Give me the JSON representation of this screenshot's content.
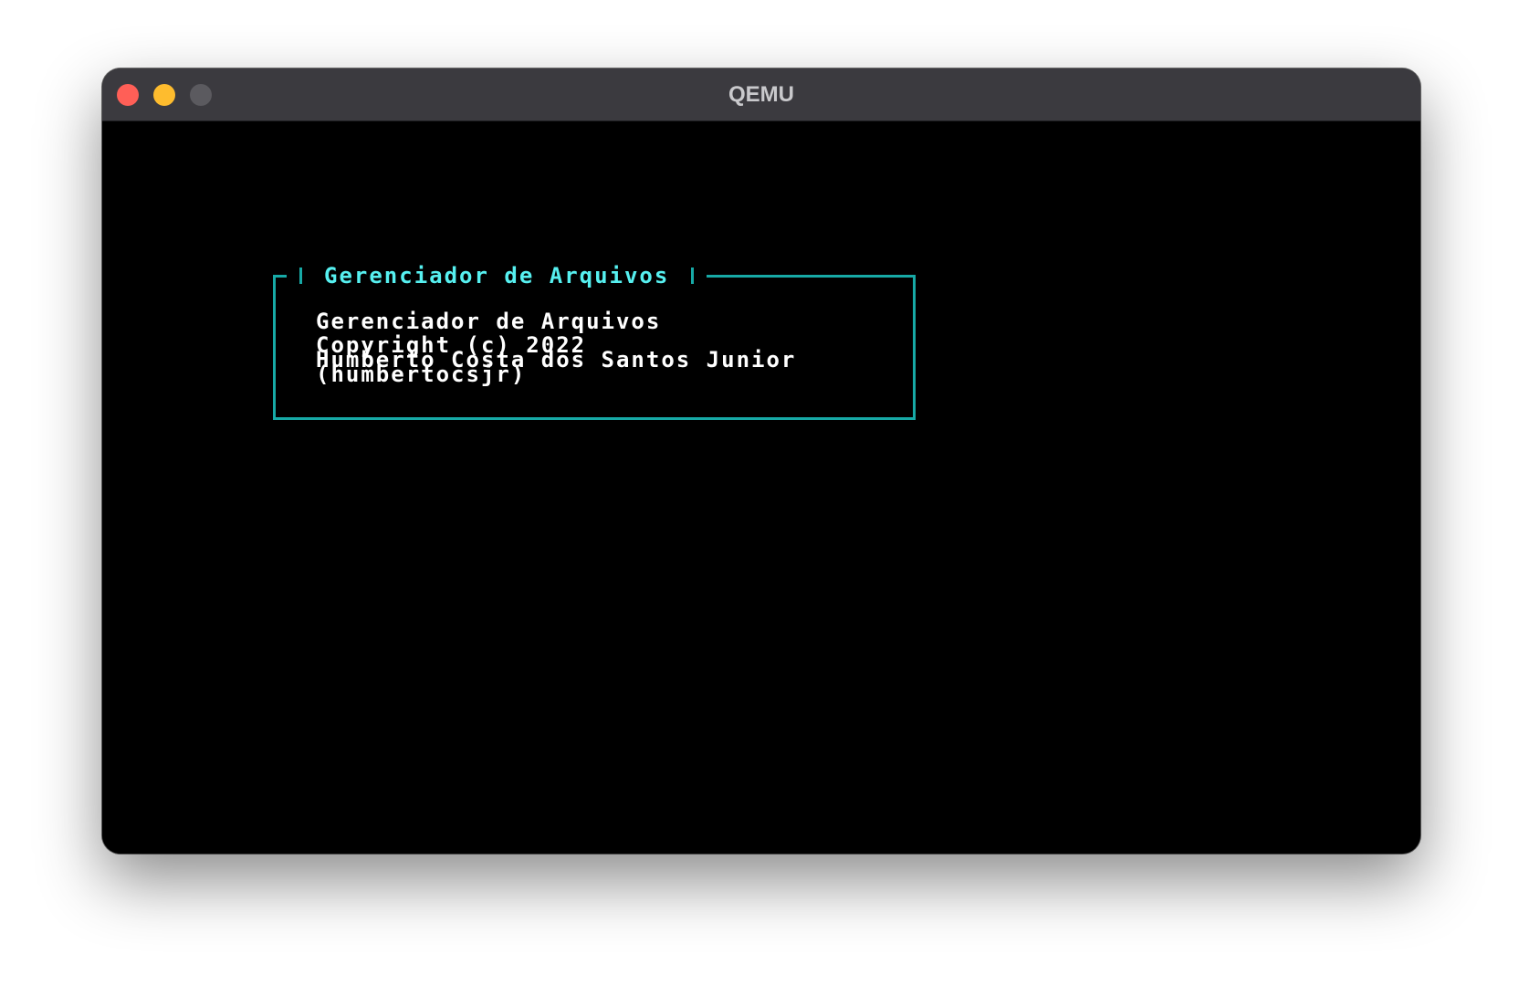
{
  "window": {
    "title": "QEMU",
    "controls": [
      "close",
      "minimize",
      "zoom"
    ]
  },
  "dialog": {
    "title": "Gerenciador de Arquivos",
    "app_name": "Gerenciador de Arquivos",
    "copyright": "Copyright (c) 2022",
    "author": "Humberto Costa dos Santos Junior",
    "handle": "(humbertocsjr)"
  },
  "colors": {
    "titlebar": "#3b3a3f",
    "screen": "#000000",
    "dialog_border": "#17a9a6",
    "dialog_title": "#56f0f0",
    "body_text": "#ffffff",
    "close": "#ff5f57",
    "minimize": "#febc2e",
    "zoom": "#5b5a5f"
  }
}
